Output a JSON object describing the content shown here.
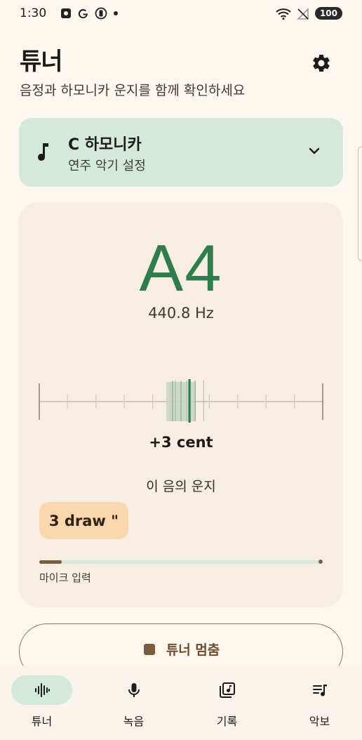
{
  "status_bar": {
    "time": "1:30",
    "battery": "100"
  },
  "header": {
    "title": "튜너",
    "subtitle": "음정과 하모니카 운지를 함께 확인하세요",
    "settings_icon": "gear-icon"
  },
  "instrument": {
    "name": "C 하모니카",
    "subtitle": "연주 악기 설정",
    "icon": "music-note-icon"
  },
  "tuner": {
    "note": "A4",
    "frequency": "440.8 Hz",
    "cent_text": "+3 cent",
    "cents": 3,
    "cent_range": [
      -50,
      50
    ],
    "hole_heading": "이 음의 운지",
    "hole_chip": "3 draw \"",
    "mic_label": "마이크 입력",
    "mic_level": 0.08
  },
  "stop_button": {
    "label": "튜너 멈춤"
  },
  "nav": {
    "items": [
      {
        "label": "튜너",
        "icon": "waveform-icon",
        "active": true
      },
      {
        "label": "녹음",
        "icon": "mic-icon",
        "active": false
      },
      {
        "label": "기록",
        "icon": "library-music-icon",
        "active": false
      },
      {
        "label": "악보",
        "icon": "queue-music-icon",
        "active": false
      }
    ]
  },
  "colors": {
    "accent_green": "#2f7d4c",
    "card_green": "#d5e8dc",
    "chip_orange": "#fbd7ad",
    "brown": "#7a5c3e"
  }
}
